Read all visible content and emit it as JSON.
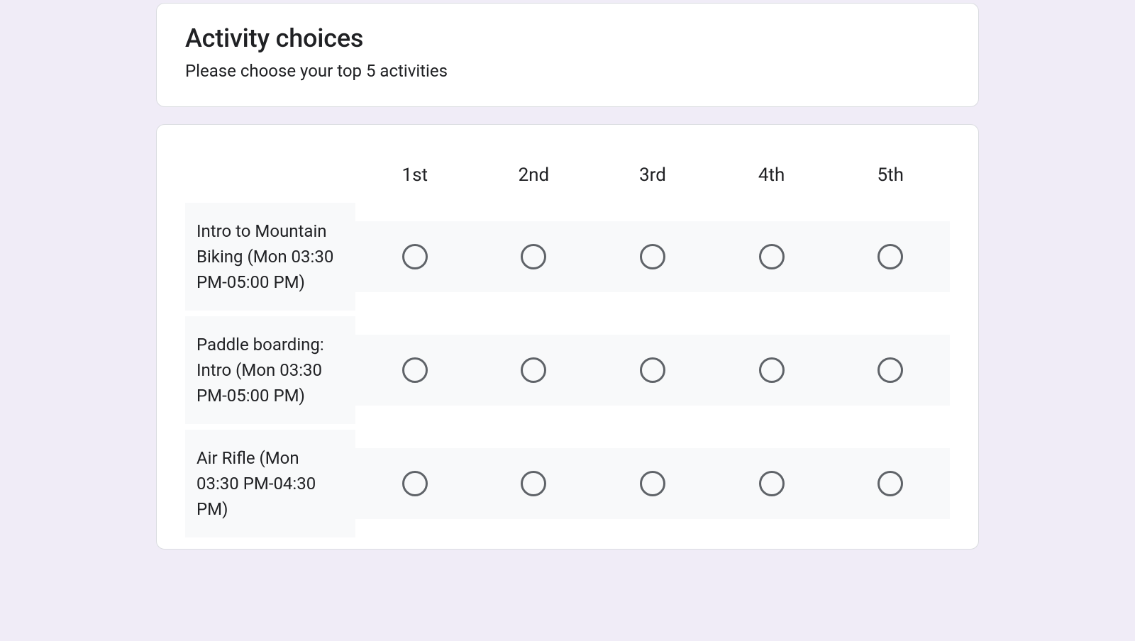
{
  "header": {
    "title": "Activity choices",
    "description": "Please choose your top 5 activities"
  },
  "grid": {
    "columns": [
      "1st",
      "2nd",
      "3rd",
      "4th",
      "5th"
    ],
    "rows": [
      {
        "label": "Intro to Mountain Biking (Mon 03:30 PM-05:00 PM)"
      },
      {
        "label": "Paddle boarding: Intro (Mon 03:30 PM-05:00 PM)"
      },
      {
        "label": "Air Rifle (Mon 03:30 PM-04:30 PM)"
      }
    ]
  }
}
